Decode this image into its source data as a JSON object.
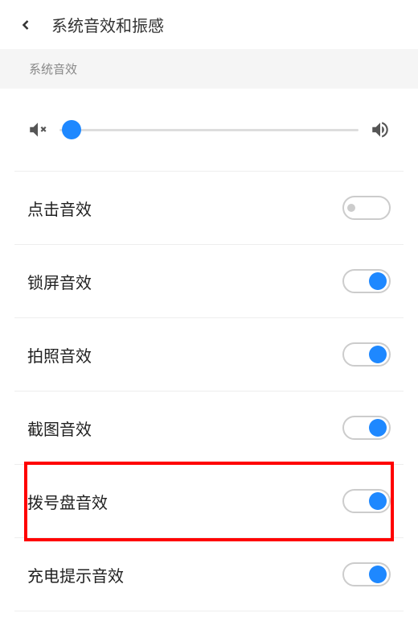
{
  "header": {
    "title": "系统音效和振感"
  },
  "section": {
    "title": "系统音效"
  },
  "slider": {
    "value": 4
  },
  "settings": [
    {
      "label": "点击音效",
      "on": false,
      "highlighted": false
    },
    {
      "label": "锁屏音效",
      "on": true,
      "highlighted": false
    },
    {
      "label": "拍照音效",
      "on": true,
      "highlighted": false
    },
    {
      "label": "截图音效",
      "on": true,
      "highlighted": false
    },
    {
      "label": "拨号盘音效",
      "on": true,
      "highlighted": true
    },
    {
      "label": "充电提示音效",
      "on": true,
      "highlighted": false
    }
  ]
}
